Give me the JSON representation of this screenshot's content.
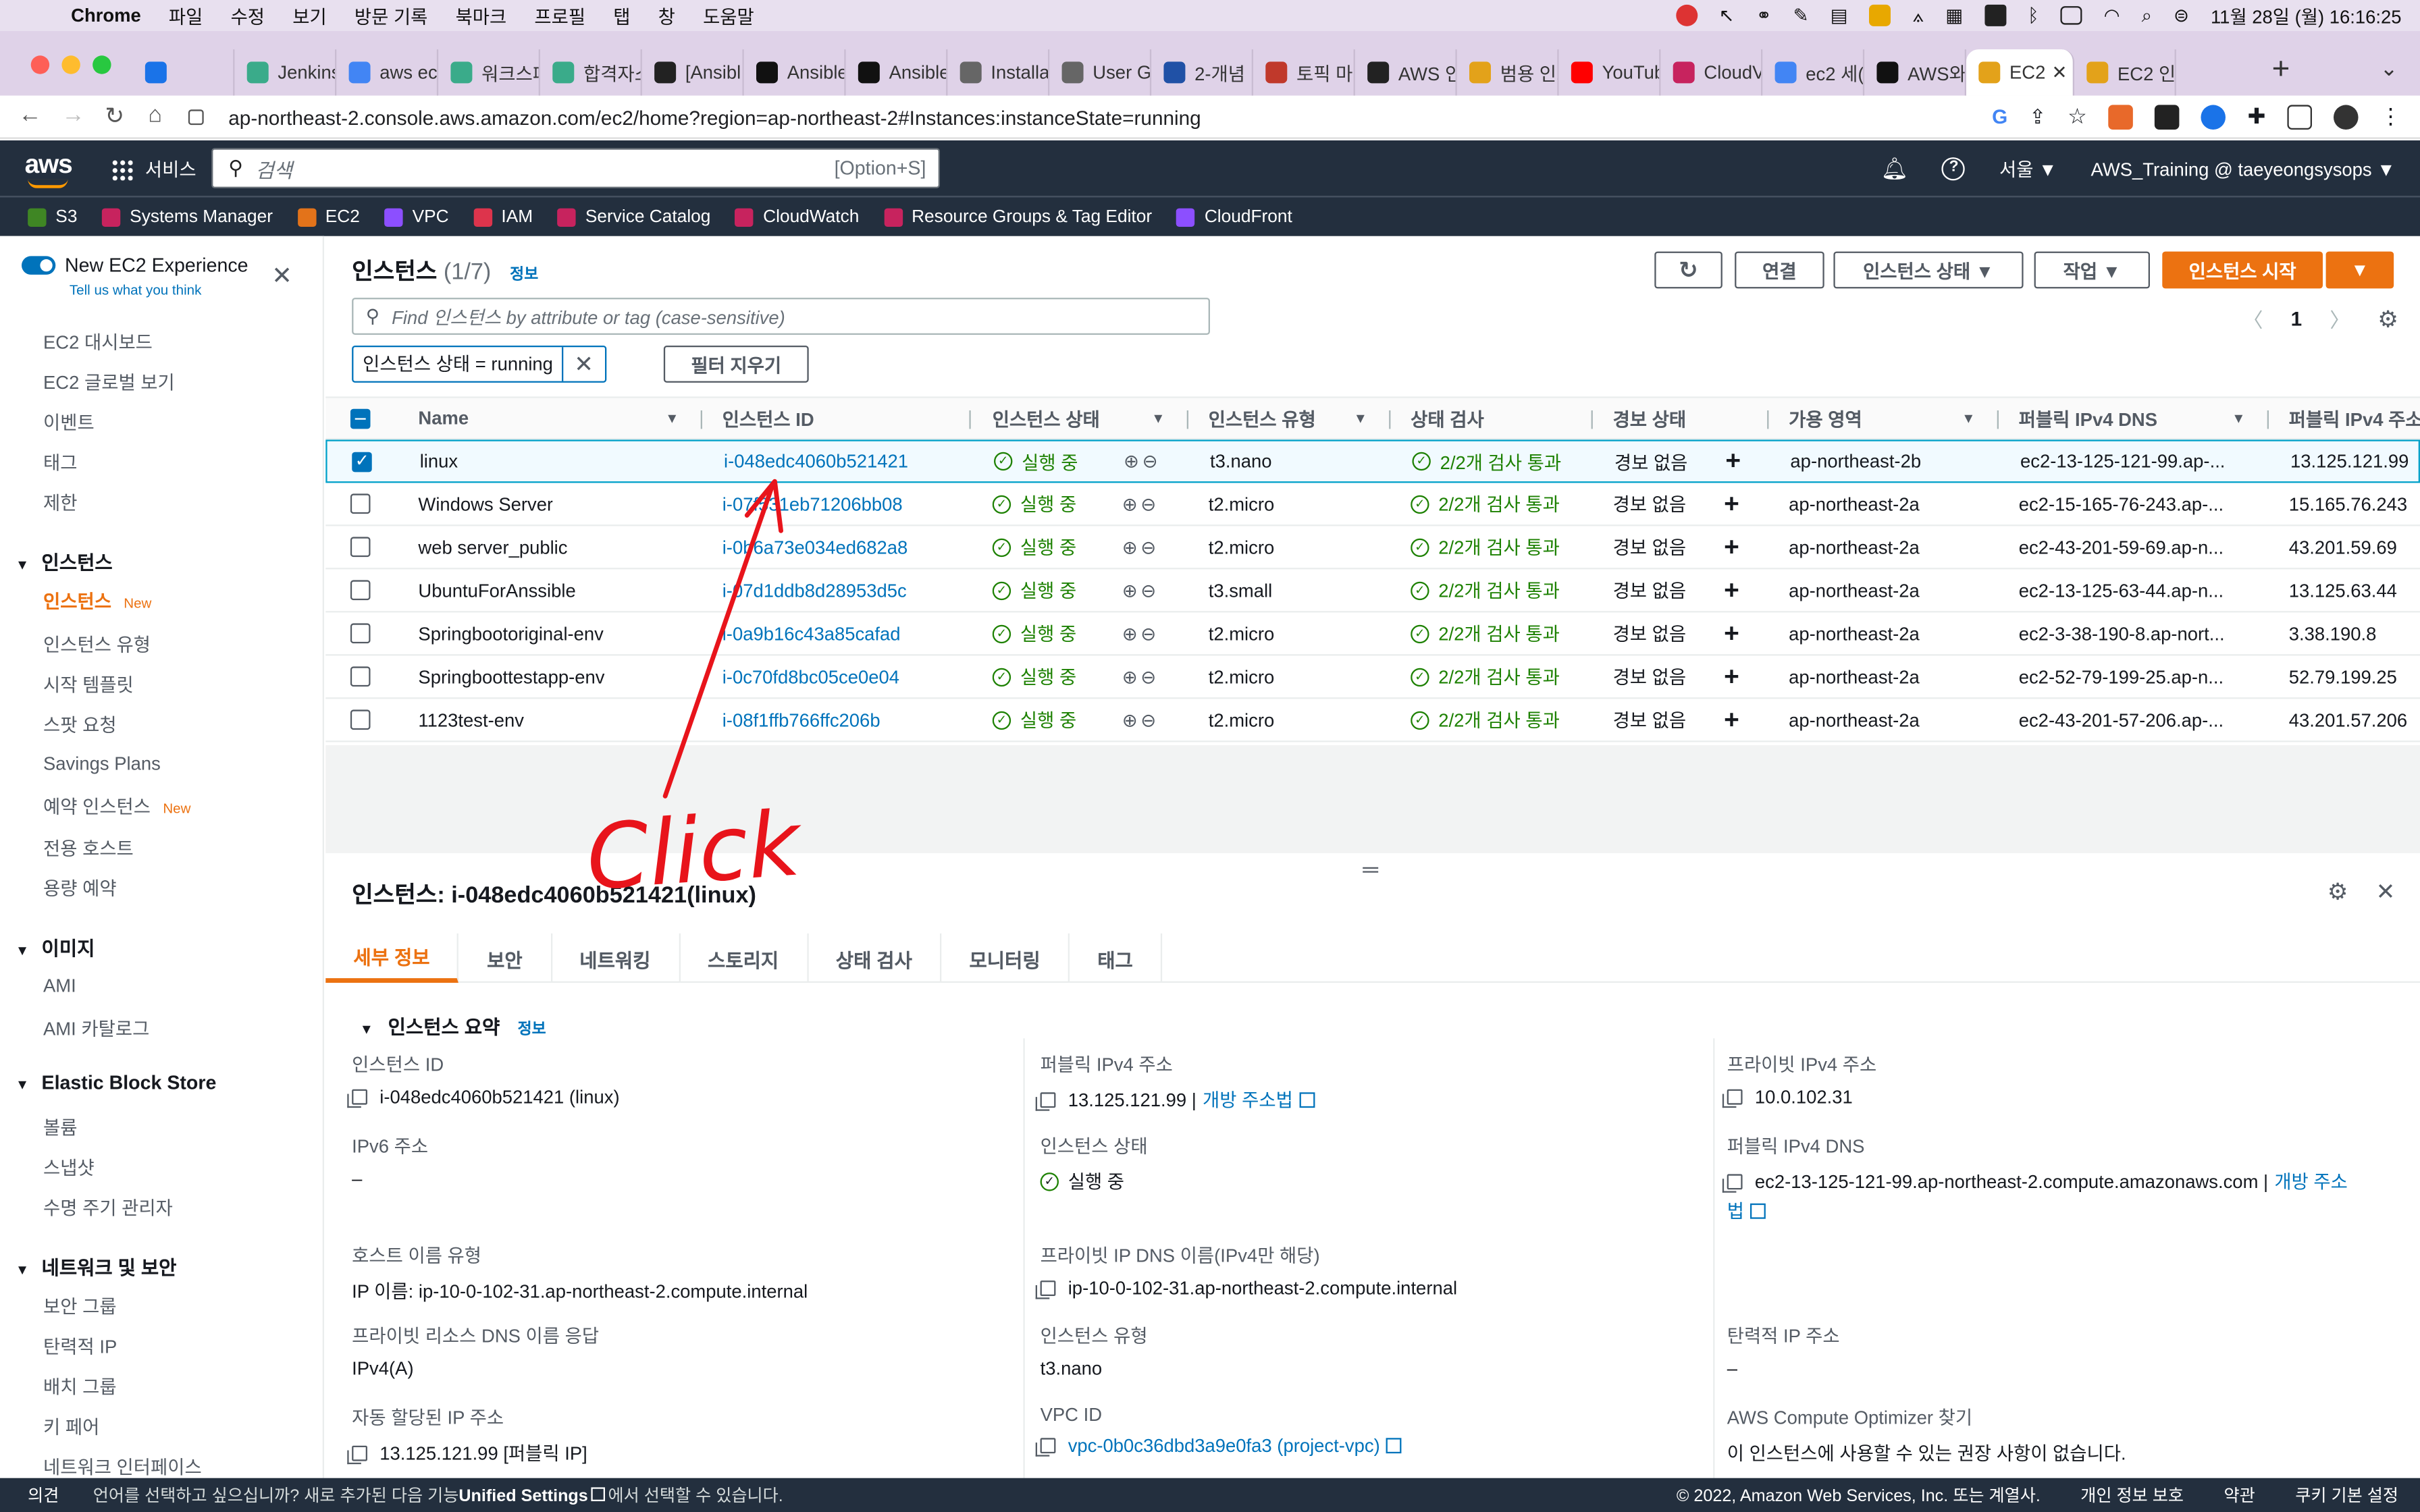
{
  "macbar": {
    "apple": "",
    "menus": [
      "Chrome",
      "파일",
      "수정",
      "보기",
      "방문 기록",
      "북마크",
      "프로필",
      "탭",
      "창",
      "도움말"
    ],
    "datetime": "11월 28일 (월)  16:16:25"
  },
  "tabs": [
    {
      "title": "",
      "color": "#1a73e8"
    },
    {
      "title": "Jenkins",
      "color": "#3aab8a"
    },
    {
      "title": "aws ec",
      "color": "#4285f4"
    },
    {
      "title": "워크스페",
      "color": "#3aab8a"
    },
    {
      "title": "합격자소",
      "color": "#3aab8a"
    },
    {
      "title": "[Ansibl",
      "color": "#222222"
    },
    {
      "title": "Ansible",
      "color": "#111111"
    },
    {
      "title": "Ansible",
      "color": "#111111"
    },
    {
      "title": "Installa",
      "color": "#666666"
    },
    {
      "title": "User G",
      "color": "#666666"
    },
    {
      "title": "2-개념",
      "color": "#2051a6"
    },
    {
      "title": "토픽 마(",
      "color": "#c0392b"
    },
    {
      "title": "AWS 인",
      "color": "#222222"
    },
    {
      "title": "범용 인스",
      "color": "#e3a21a"
    },
    {
      "title": "YouTub",
      "color": "#ff0000"
    },
    {
      "title": "CloudV",
      "color": "#c7235e"
    },
    {
      "title": "ec2 세(",
      "color": "#4285f4"
    },
    {
      "title": "AWS와",
      "color": "#111111"
    },
    {
      "title": "EC2",
      "color": "#e3a21a",
      "active": true
    },
    {
      "title": "EC2 인",
      "color": "#e3a21a"
    }
  ],
  "address": {
    "url": "ap-northeast-2.console.aws.amazon.com/ec2/home?region=ap-northeast-2#Instances:instanceState=running"
  },
  "aws_header": {
    "logo": "aws",
    "services_label": "서비스",
    "search_placeholder": "검색",
    "search_hint": "[Option+S]",
    "region": "서울 ▼",
    "account": "AWS_Training @ taeyeongsysops ▼"
  },
  "favorites": [
    {
      "label": "S3",
      "color": "#3f8624"
    },
    {
      "label": "Systems Manager",
      "color": "#c7235e"
    },
    {
      "label": "EC2",
      "color": "#e3731a"
    },
    {
      "label": "VPC",
      "color": "#8c4fff"
    },
    {
      "label": "IAM",
      "color": "#dd344c"
    },
    {
      "label": "Service Catalog",
      "color": "#c7235e"
    },
    {
      "label": "CloudWatch",
      "color": "#c7235e"
    },
    {
      "label": "Resource Groups & Tag Editor",
      "color": "#c7235e"
    },
    {
      "label": "CloudFront",
      "color": "#8c4fff"
    }
  ],
  "sidebar": {
    "new_experience": "New EC2 Experience",
    "tell_us": "Tell us what you think",
    "items": [
      {
        "label": "EC2 대시보드"
      },
      {
        "label": "EC2 글로벌 보기"
      },
      {
        "label": "이벤트"
      },
      {
        "label": "태그"
      },
      {
        "label": "제한"
      }
    ],
    "sections": [
      {
        "title": "인스턴스",
        "items": [
          "인스턴스",
          "인스턴스 유형",
          "시작 템플릿",
          "스팟 요청",
          "Savings Plans",
          "예약 인스턴스",
          "전용 호스트",
          "용량 예약"
        ]
      },
      {
        "title": "이미지",
        "items": [
          "AMI",
          "AMI 카탈로그"
        ]
      },
      {
        "title": "Elastic Block Store",
        "items": [
          "볼륨",
          "스냅샷",
          "수명 주기 관리자"
        ]
      },
      {
        "title": "네트워크 및 보안",
        "items": [
          "보안 그룹",
          "탄력적 IP",
          "배치 그룹",
          "키 페어",
          "네트워크 인터페이스"
        ]
      }
    ],
    "new_tag": "New"
  },
  "main": {
    "title": "인스턴스",
    "count": "(1/7)",
    "info": "정보",
    "buttons": {
      "connect": "연결",
      "state": "인스턴스 상태 ▼",
      "actions": "작업 ▼",
      "launch": "인스턴스 시작"
    },
    "filter_placeholder": "Find 인스턴스 by attribute or tag (case-sensitive)",
    "token": "인스턴스 상태 = running",
    "clear_filters": "필터 지우기",
    "page": "1"
  },
  "table": {
    "headers": [
      "Name",
      "인스턴스 ID",
      "인스턴스 상태",
      "인스턴스 유형",
      "상태 검사",
      "경보 상태",
      "가용 영역",
      "퍼블릭 IPv4 DNS",
      "퍼블릭 IPv4 주소"
    ],
    "rows": [
      {
        "name": "linux",
        "id": "i-048edc4060b521421",
        "state": "실행 중",
        "type": "t3.nano",
        "check": "2/2개 검사 통과",
        "alarm": "경보 없음",
        "az": "ap-northeast-2b",
        "dns": "ec2-13-125-121-99.ap-...",
        "ip": "13.125.121.99",
        "selected": true
      },
      {
        "name": "Windows Server",
        "id": "i-07f531eb71206bb08",
        "state": "실행 중",
        "type": "t2.micro",
        "check": "2/2개 검사 통과",
        "alarm": "경보 없음",
        "az": "ap-northeast-2a",
        "dns": "ec2-15-165-76-243.ap-...",
        "ip": "15.165.76.243"
      },
      {
        "name": "web server_public",
        "id": "i-0b6a73e034ed682a8",
        "state": "실행 중",
        "type": "t2.micro",
        "check": "2/2개 검사 통과",
        "alarm": "경보 없음",
        "az": "ap-northeast-2a",
        "dns": "ec2-43-201-59-69.ap-n...",
        "ip": "43.201.59.69"
      },
      {
        "name": "UbuntuForAnssible",
        "id": "i-07d1ddb8d28953d5c",
        "state": "실행 중",
        "type": "t3.small",
        "check": "2/2개 검사 통과",
        "alarm": "경보 없음",
        "az": "ap-northeast-2a",
        "dns": "ec2-13-125-63-44.ap-n...",
        "ip": "13.125.63.44"
      },
      {
        "name": "Springbootoriginal-env",
        "id": "i-0a9b16c43a85cafad",
        "state": "실행 중",
        "type": "t2.micro",
        "check": "2/2개 검사 통과",
        "alarm": "경보 없음",
        "az": "ap-northeast-2a",
        "dns": "ec2-3-38-190-8.ap-nort...",
        "ip": "3.38.190.8"
      },
      {
        "name": "Springboottestapp-env",
        "id": "i-0c70fd8bc05ce0e04",
        "state": "실행 중",
        "type": "t2.micro",
        "check": "2/2개 검사 통과",
        "alarm": "경보 없음",
        "az": "ap-northeast-2a",
        "dns": "ec2-52-79-199-25.ap-n...",
        "ip": "52.79.199.25"
      },
      {
        "name": "1123test-env",
        "id": "i-08f1ffb766ffc206b",
        "state": "실행 중",
        "type": "t2.micro",
        "check": "2/2개 검사 통과",
        "alarm": "경보 없음",
        "az": "ap-northeast-2a",
        "dns": "ec2-43-201-57-206.ap-...",
        "ip": "43.201.57.206"
      }
    ]
  },
  "detail": {
    "title": "인스턴스: i-048edc4060b521421(linux)",
    "tabs": [
      "세부 정보",
      "보안",
      "네트워킹",
      "스토리지",
      "상태 검사",
      "모니터링",
      "태그"
    ],
    "section": "인스턴스 요약",
    "section_info": "정보",
    "col1": [
      {
        "label": "인스턴스 ID",
        "value": "i-048edc4060b521421 (linux)"
      },
      {
        "label": "IPv6 주소",
        "value": "–"
      },
      {
        "label": "호스트 이름 유형",
        "value": "IP 이름: ip-10-0-102-31.ap-northeast-2.compute.internal"
      },
      {
        "label": "프라이빗 리소스 DNS 이름 응답",
        "value": "IPv4(A)"
      },
      {
        "label": "자동 할당된 IP 주소",
        "value": "13.125.121.99 [퍼블릭 IP]"
      }
    ],
    "col2": [
      {
        "label": "퍼블릭 IPv4 주소",
        "value": "13.125.121.99 |",
        "link": "개방 주소법"
      },
      {
        "label": "인스턴스 상태",
        "value": "실행 중"
      },
      {
        "label": "프라이빗 IP DNS 이름(IPv4만 해당)",
        "value": "ip-10-0-102-31.ap-northeast-2.compute.internal"
      },
      {
        "label": "인스턴스 유형",
        "value": "t3.nano"
      },
      {
        "label": "VPC ID",
        "value": "vpc-0b0c36dbd3a9e0fa3 (project-vpc)"
      }
    ],
    "col3": [
      {
        "label": "프라이빗 IPv4 주소",
        "value": "10.0.102.31"
      },
      {
        "label": "퍼블릭 IPv4 DNS",
        "value": "ec2-13-125-121-99.ap-northeast-2.compute.amazonaws.com |",
        "link": "개방 주소",
        "link2": "법"
      },
      {
        "label": "탄력적 IP 주소",
        "value": "–"
      },
      {
        "label": "AWS Compute Optimizer 찾기",
        "value": "이 인스턴스에 사용할 수 있는 권장 사항이 없습니다."
      }
    ]
  },
  "annotation": {
    "text": "Click"
  },
  "footer": {
    "feedback": "의견",
    "message_pre": "언어를 선택하고 싶으십니까? 새로 추가된 다음 기능",
    "message_bold": "Unified Settings",
    "message_post": "에서 선택할 수 있습니다.",
    "copyright": "© 2022, Amazon Web Services, Inc. 또는 계열사.",
    "privacy": "개인 정보 보호",
    "terms": "약관",
    "cookies": "쿠키 기본 설정"
  }
}
